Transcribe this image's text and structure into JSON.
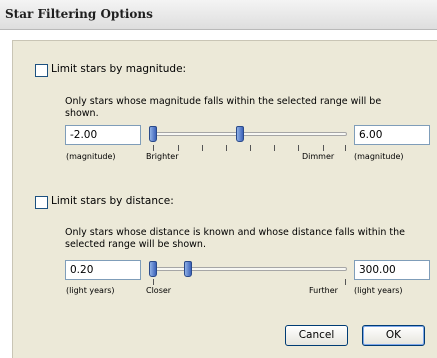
{
  "window": {
    "title": "Star Filtering Options"
  },
  "magnitude": {
    "checkbox_label": "Limit stars by magnitude:",
    "checked": false,
    "description": "Only stars whose magnitude falls within the selected range will be shown.",
    "min_value": "-2.00",
    "max_value": "6.00",
    "min_unit": "(magnitude)",
    "max_unit": "(magnitude)",
    "slider_left_label": "Brighter",
    "slider_right_label": "Dimmer"
  },
  "distance": {
    "checkbox_label": "Limit stars by distance:",
    "checked": false,
    "description": "Only stars whose distance is known and whose distance falls within the selected range will be shown.",
    "min_value": "0.20",
    "max_value": "300.00",
    "min_unit": "(light years)",
    "max_unit": "(light years)",
    "slider_left_label": "Closer",
    "slider_right_label": "Further"
  },
  "buttons": {
    "cancel": "Cancel",
    "ok": "OK"
  },
  "icons": {
    "slider_thumb": "slider-thumb-icon"
  }
}
